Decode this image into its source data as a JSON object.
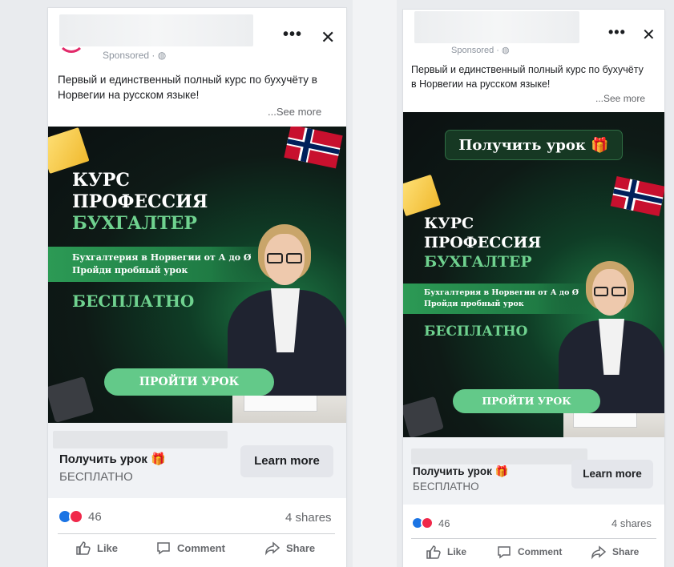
{
  "ad": {
    "sponsored": "Sponsored · ",
    "more_icon": "more-horizontal-icon",
    "close_icon": "close-icon",
    "caption": "Первый и единственный полный курс по бухучёту в Норвегии на русском языке!",
    "see_more": "...See more",
    "creative": {
      "top_button": "Получить урок 🎁",
      "line1": "КУРС",
      "line2": "ПРОФЕССИЯ",
      "line3": "БУХГАЛТЕР",
      "band1": "Бухгалтерия в Норвегии от А до Ø",
      "band2": "Пройди пробный урок",
      "free": "БЕСПЛАТНО",
      "cta": "ПРОЙТИ УРОК"
    },
    "link": {
      "title": "Получить урок 🎁",
      "subtitle": "БЕСПЛАТНО",
      "button": "Learn more"
    },
    "reactions_count": "46",
    "shares": "4 shares",
    "actions": {
      "like": "Like",
      "comment": "Comment",
      "share": "Share"
    }
  },
  "colors": {
    "accent_green": "#6fd28f",
    "fb_blue": "#1b74e4",
    "love_red": "#f0284a"
  }
}
